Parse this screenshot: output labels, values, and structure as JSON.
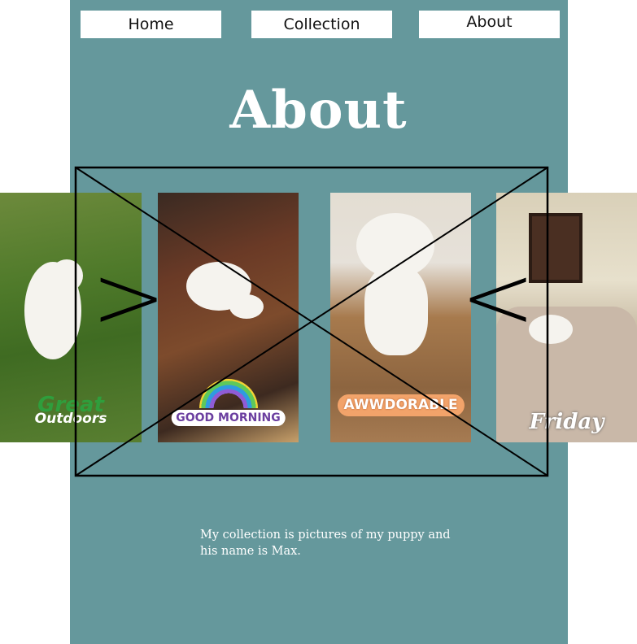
{
  "nav": {
    "home_label": "Home",
    "collection_label": "Collection",
    "about_label": "About"
  },
  "page": {
    "title": "About",
    "description": "My collection is pictures of my puppy and his name is Max."
  },
  "carousel": {
    "prev_symbol": ">",
    "next_symbol": "<",
    "photos": [
      {
        "sticker": "Great",
        "sticker_sub": "Outdoors"
      },
      {
        "sticker": "GOOD MORNING"
      },
      {
        "sticker": "AWWDORABLE"
      },
      {
        "sticker": "Friday"
      }
    ]
  },
  "colors": {
    "panel": "#65989c",
    "text": "#ffffff"
  }
}
